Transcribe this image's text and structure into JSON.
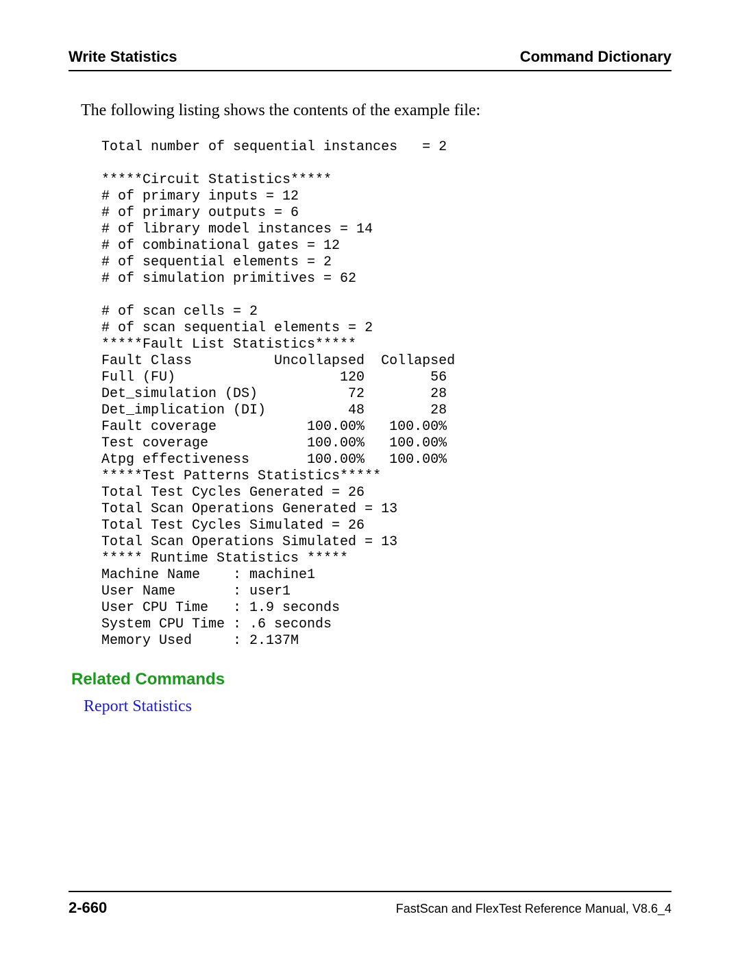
{
  "header": {
    "left": "Write Statistics",
    "right": "Command Dictionary"
  },
  "intro": "The following listing shows the contents of the example file:",
  "listing": "Total number of sequential instances   = 2\n\n*****Circuit Statistics*****\n# of primary inputs = 12\n# of primary outputs = 6\n# of library model instances = 14\n# of combinational gates = 12\n# of sequential elements = 2\n# of simulation primitives = 62\n\n# of scan cells = 2\n# of scan sequential elements = 2\n*****Fault List Statistics*****\nFault Class          Uncollapsed  Collapsed\nFull (FU)                    120        56\nDet_simulation (DS)           72        28\nDet_implication (DI)          48        28\nFault coverage           100.00%   100.00%\nTest coverage            100.00%   100.00%\nAtpg effectiveness       100.00%   100.00%\n*****Test Patterns Statistics*****\nTotal Test Cycles Generated = 26\nTotal Scan Operations Generated = 13\nTotal Test Cycles Simulated = 26\nTotal Scan Operations Simulated = 13\n***** Runtime Statistics *****\nMachine Name    : machine1\nUser Name       : user1\nUser CPU Time   : 1.9 seconds\nSystem CPU Time : .6 seconds\nMemory Used     : 2.137M",
  "related": {
    "heading": "Related Commands",
    "link": "Report Statistics"
  },
  "footer": {
    "page": "2-660",
    "manual": "FastScan and FlexTest Reference Manual, V8.6_4"
  }
}
